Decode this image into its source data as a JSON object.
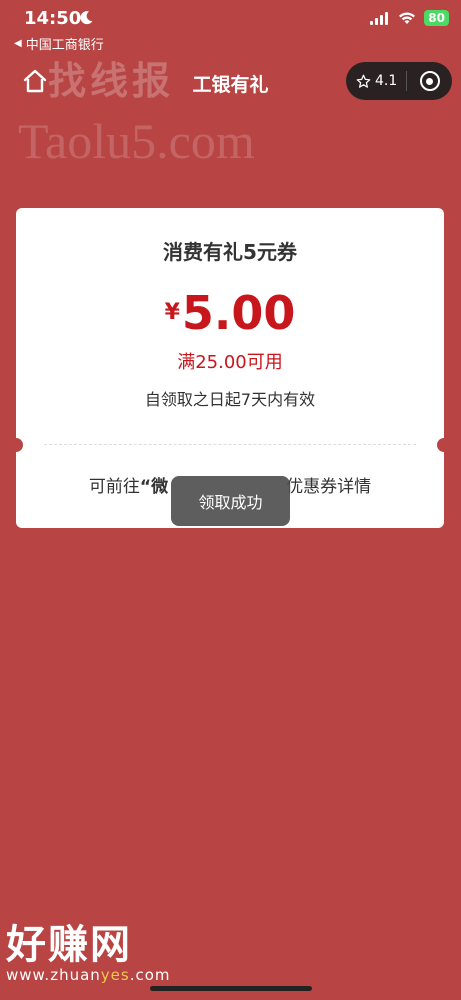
{
  "status_bar": {
    "time": "14:50",
    "battery": "80",
    "back_app_label": "中国工商银行",
    "icons": [
      "moon-icon",
      "signal-icon",
      "wifi-icon",
      "battery-icon"
    ]
  },
  "nav": {
    "title": "工银有礼",
    "rating": "4.1",
    "icons": [
      "home-icon",
      "star-icon",
      "target-icon"
    ]
  },
  "watermarks": {
    "top_text": "找线报",
    "site_text": "Taolu5.com",
    "bottom_cn": "好赚网",
    "bottom_url_prefix": "www.zhuan",
    "bottom_url_highlight": "yes",
    "bottom_url_suffix": ".com"
  },
  "coupon": {
    "title": "消费有礼5元券",
    "currency": "¥",
    "amount": "5.00",
    "threshold": "满25.00可用",
    "validity": "自领取之日起7天内有效",
    "hint_prefix": "可前往",
    "hint_bold": "“微",
    "hint_suffix": "优惠券详情"
  },
  "toast": {
    "message": "领取成功"
  },
  "colors": {
    "background": "#b84444",
    "accent_red": "#c8161d",
    "card": "#ffffff",
    "toast": "#505050"
  }
}
